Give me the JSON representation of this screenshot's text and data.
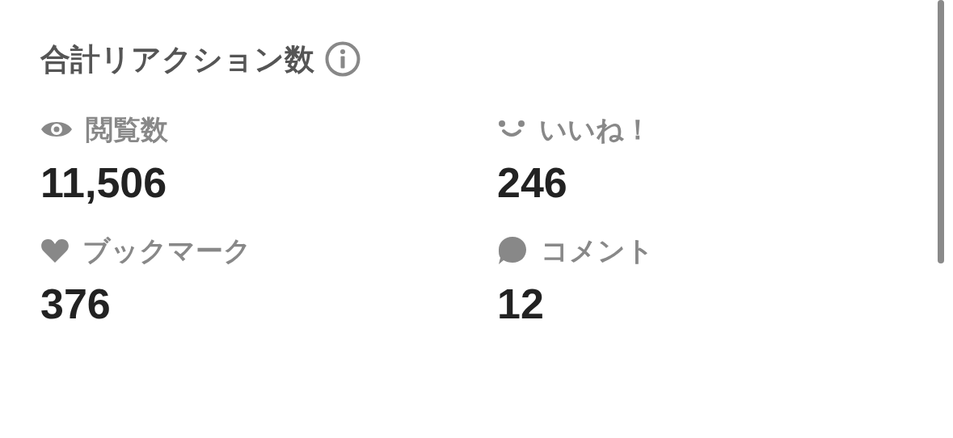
{
  "title": "合計リアクション数",
  "stats": [
    {
      "kind": "views",
      "label": "閲覧数",
      "value": "11,506"
    },
    {
      "kind": "likes",
      "label": "いいね！",
      "value": "246"
    },
    {
      "kind": "bookmarks",
      "label": "ブックマーク",
      "value": "376"
    },
    {
      "kind": "comments",
      "label": "コメント",
      "value": "12"
    }
  ]
}
